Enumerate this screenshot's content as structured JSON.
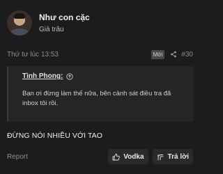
{
  "author": {
    "name": "Như con cặc",
    "title": "Già trâu"
  },
  "post": {
    "time": "Thứ tư lúc 13:53",
    "badge": "Mới",
    "number": "#30",
    "quote": {
      "author": "Tình Phong:",
      "text": "Bạn ơi đừng làm thế nữa, bên cảnh sát điều tra đã inbox tôi rồi."
    },
    "message": "ĐỪNG NÓI NHIỀU VỚI TAO"
  },
  "actions": {
    "report": "Report",
    "like_label": "Vodka",
    "reply_label": "Trả lời"
  },
  "colors": {
    "background": "#1c1c1e",
    "quote_background": "#252527",
    "muted_text": "#8e8e93"
  },
  "icons": [
    "share-icon",
    "arrow-up-circle-icon",
    "thumbs-up-icon",
    "reply-icon"
  ]
}
